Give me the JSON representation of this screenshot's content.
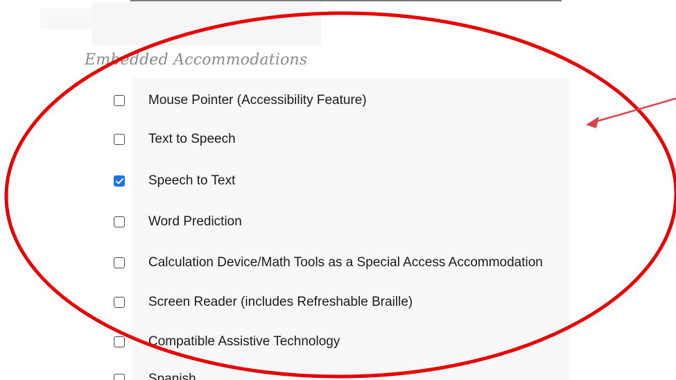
{
  "section": {
    "heading": "Embedded Accommodations"
  },
  "options": [
    {
      "label": "Mouse Pointer (Accessibility Feature)",
      "checked": false
    },
    {
      "label": "Text to Speech",
      "checked": false
    },
    {
      "label": "Speech to Text",
      "checked": true
    },
    {
      "label": "Word Prediction",
      "checked": false
    },
    {
      "label": "Calculation Device/Math Tools as a Special Access Accommodation",
      "checked": false
    },
    {
      "label": "Screen Reader (includes Refreshable Braille)",
      "checked": false
    },
    {
      "label": "Compatible Assistive Technology",
      "checked": false
    },
    {
      "label": "Spanish",
      "checked": false
    }
  ],
  "annotation": {
    "color": "#e60000",
    "arrow_color": "#d9444c"
  },
  "colors": {
    "checkbox_checked": "#1a73e8"
  }
}
